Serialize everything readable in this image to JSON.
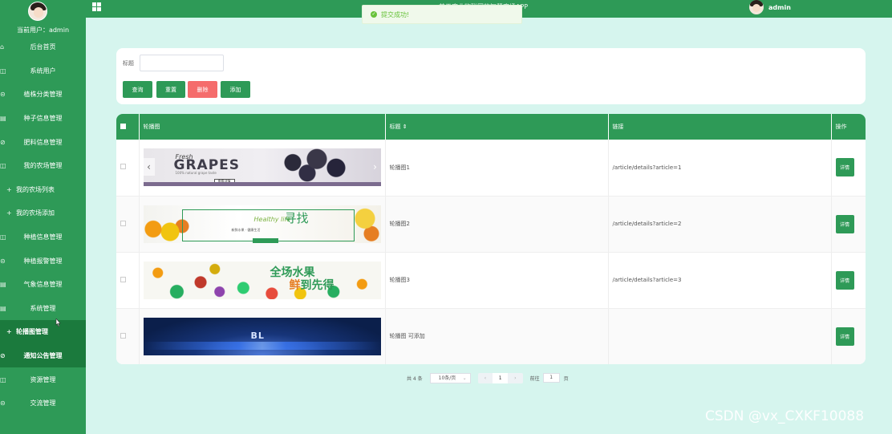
{
  "sidebar": {
    "current_user": "当前用户：admin",
    "items": [
      {
        "label": "后台首页",
        "icon": "home-icon",
        "glyph": "⌂",
        "sub": false,
        "active": false
      },
      {
        "label": "系统用户",
        "icon": "user-icon",
        "glyph": "◫",
        "sub": false,
        "active": false
      },
      {
        "label": "植株分类管理",
        "icon": "category-icon",
        "glyph": "⊝",
        "sub": false,
        "active": false
      },
      {
        "label": "种子信息管理",
        "icon": "doc-icon",
        "glyph": "▤",
        "sub": false,
        "active": false
      },
      {
        "label": "肥料信息管理",
        "icon": "check-circle-icon",
        "glyph": "⊘",
        "sub": false,
        "active": false
      },
      {
        "label": "我的农场管理",
        "icon": "farm-icon",
        "glyph": "◫",
        "sub": false,
        "active": false
      },
      {
        "label": "我的农场列表",
        "icon": "plus-icon",
        "glyph": "+",
        "sub": true,
        "active": false
      },
      {
        "label": "我的农场添加",
        "icon": "plus-icon",
        "glyph": "+",
        "sub": true,
        "active": false
      },
      {
        "label": "种植信息管理",
        "icon": "grid-icon",
        "glyph": "◫",
        "sub": false,
        "active": false
      },
      {
        "label": "种植报警管理",
        "icon": "alarm-icon",
        "glyph": "⊝",
        "sub": false,
        "active": false
      },
      {
        "label": "气象信息管理",
        "icon": "weather-icon",
        "glyph": "▤",
        "sub": false,
        "active": false
      },
      {
        "label": "系统管理",
        "icon": "settings-icon",
        "glyph": "▤",
        "sub": false,
        "active": false
      },
      {
        "label": "轮播图管理",
        "icon": "plus-icon",
        "glyph": "+",
        "sub": true,
        "active": true
      },
      {
        "label": "通知公告管理",
        "icon": "check-circle-icon",
        "glyph": "⊘",
        "sub": false,
        "active": true
      },
      {
        "label": "资源管理",
        "icon": "resource-icon",
        "glyph": "◫",
        "sub": false,
        "active": false
      },
      {
        "label": "交流管理",
        "icon": "chat-icon",
        "glyph": "⊝",
        "sub": false,
        "active": false
      }
    ]
  },
  "topbar": {
    "title": "基于农业物联网的智慧农场APP",
    "user": "admin"
  },
  "toast": {
    "text": "提交成功!"
  },
  "search": {
    "label": "标题",
    "placeholder": "",
    "query_btn": "查询",
    "reset_btn": "重置",
    "delete_btn": "删除",
    "add_btn": "添加"
  },
  "table": {
    "headers": {
      "image": "轮播图",
      "title": "标题 ⇕",
      "link": "链接",
      "action": "操作"
    },
    "rows": [
      {
        "title": "轮播图1",
        "link": "/article/details?article=1",
        "action": "详情"
      },
      {
        "title": "轮播图2",
        "link": "/article/details?article=2",
        "action": "详情"
      },
      {
        "title": "轮播图3",
        "link": "/article/details?article=3",
        "action": "详情"
      },
      {
        "title": "轮播图 可添加",
        "link": "",
        "action": "详情"
      }
    ]
  },
  "banners": {
    "b1": {
      "fresh": "Fresh",
      "grapes": "GRAPES",
      "sub": "100% natural grape taste",
      "btn": "查看详情"
    },
    "b2": {
      "healthy": "Healthy life",
      "xunzhao": "寻找",
      "small": "新鲜水果 · 健康生活"
    },
    "b3": {
      "line1": "全场水果",
      "line2a": "鲜",
      "line2b": "到先得"
    },
    "b4": {
      "text": "BL"
    }
  },
  "pager": {
    "total": "共 4 条",
    "page_size": "10条/页",
    "prev": "‹",
    "current": "1",
    "next": "›",
    "goto": "前往",
    "goto_value": "1",
    "page_unit": "页"
  },
  "watermark": "CSDN @vx_CXKF10088",
  "colors": {
    "primary": "#2e9a57",
    "danger": "#f56c6c",
    "background": "#d6f5ee"
  }
}
